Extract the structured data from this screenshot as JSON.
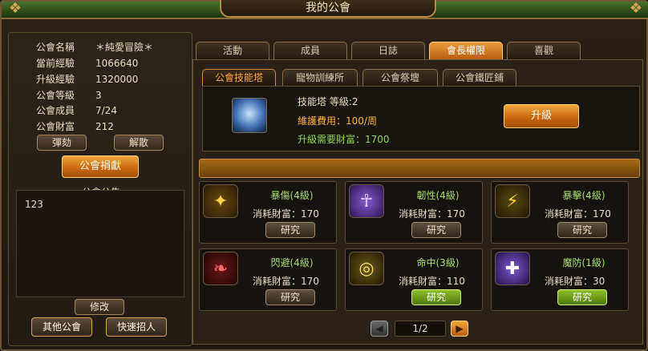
{
  "window": {
    "title": "我的公會"
  },
  "guild_info": [
    {
      "label": "公會名稱",
      "value": "＊純愛冒險＊"
    },
    {
      "label": "當前經驗",
      "value": "1066640"
    },
    {
      "label": "升級經驗",
      "value": "1320000"
    },
    {
      "label": "公會等級",
      "value": "3"
    },
    {
      "label": "公會成員",
      "value": "7/24"
    },
    {
      "label": "公會財富",
      "value": "212"
    }
  ],
  "left_buttons": {
    "impeach": "彈劾",
    "disband": "解散",
    "donate": "公會捐獻",
    "edit": "修改",
    "other_guilds": "其他公會",
    "quick_recruit": "快速招人"
  },
  "notice": {
    "title": "公會公告",
    "text": "123"
  },
  "tabs": [
    "活動",
    "成員",
    "日誌",
    "會長權限",
    "喜觀"
  ],
  "subtabs": [
    "公會技能塔",
    "寵物訓練所",
    "公會祭壇",
    "公會鐵匠鋪"
  ],
  "tower": {
    "title": "技能塔 等級:2",
    "upkeep": "維護費用：100/周",
    "upgrade_cost": "升級需要財富：1700",
    "upgrade_button": "升級"
  },
  "skills": [
    {
      "name": "暴傷(4級)",
      "cost": "消耗財富：170",
      "button": "研究",
      "icon": "critical-damage-icon",
      "ready": false
    },
    {
      "name": "韌性(4級)",
      "cost": "消耗財富：170",
      "button": "研究",
      "icon": "toughness-icon",
      "ready": false
    },
    {
      "name": "暴擊(4級)",
      "cost": "消耗財富：170",
      "button": "研究",
      "icon": "critical-strike-icon",
      "ready": false
    },
    {
      "name": "閃避(4級)",
      "cost": "消耗財富：170",
      "button": "研究",
      "icon": "dodge-icon",
      "ready": false
    },
    {
      "name": "命中(3級)",
      "cost": "消耗財富：110",
      "button": "研究",
      "icon": "accuracy-icon",
      "ready": true
    },
    {
      "name": "魔防(1級)",
      "cost": "消耗財富：30",
      "button": "研究",
      "icon": "magic-defense-icon",
      "ready": true
    }
  ],
  "pager": {
    "text": "1/2",
    "prev": "◀",
    "next": "▶"
  },
  "colors": {
    "accent_orange": "#c86410",
    "skill_name": "#a6dd6a",
    "upkeep": "#ffb43a",
    "upgrade_cost": "#8fd45a"
  }
}
